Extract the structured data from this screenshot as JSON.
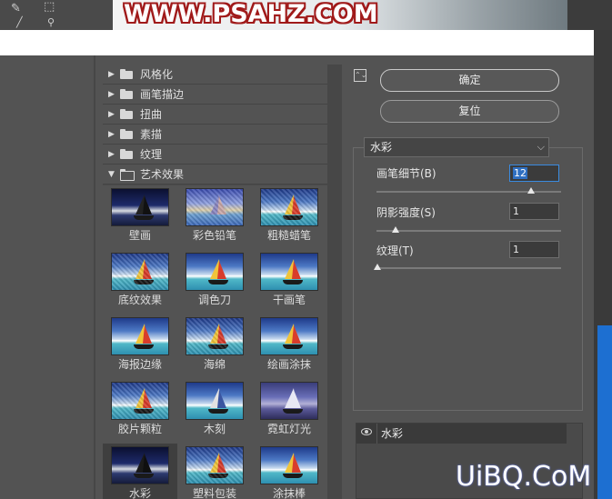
{
  "banner": {
    "text": "WWW.PSAHZ.COM"
  },
  "filter_tree": {
    "categories": [
      {
        "label": "风格化",
        "expanded": false
      },
      {
        "label": "画笔描边",
        "expanded": false
      },
      {
        "label": "扭曲",
        "expanded": false
      },
      {
        "label": "素描",
        "expanded": false
      },
      {
        "label": "纹理",
        "expanded": false
      },
      {
        "label": "艺术效果",
        "expanded": true
      }
    ],
    "thumbnails": [
      {
        "label": "壁画"
      },
      {
        "label": "彩色铅笔"
      },
      {
        "label": "粗糙蜡笔"
      },
      {
        "label": "底纹效果"
      },
      {
        "label": "调色刀"
      },
      {
        "label": "干画笔"
      },
      {
        "label": "海报边缘"
      },
      {
        "label": "海绵"
      },
      {
        "label": "绘画涂抹"
      },
      {
        "label": "胶片颗粒"
      },
      {
        "label": "木刻"
      },
      {
        "label": "霓虹灯光"
      },
      {
        "label": "水彩",
        "selected": true
      },
      {
        "label": "塑料包装"
      },
      {
        "label": "涂抹棒"
      }
    ]
  },
  "buttons": {
    "ok": "确定",
    "reset": "复位"
  },
  "filter_select": {
    "value": "水彩"
  },
  "params": [
    {
      "label": "画笔细节(B)",
      "value": "12",
      "slider_fraction": 0.84
    },
    {
      "label": "阴影强度(S)",
      "value": "1",
      "slider_fraction": 0.1
    },
    {
      "label": "纹理(T)",
      "value": "1",
      "slider_fraction": 0.0
    }
  ],
  "effect_layers": [
    {
      "name": "水彩",
      "visible": true
    }
  ],
  "watermark": {
    "text": "UiBQ.CoM"
  },
  "colors": {
    "panel": "#535353",
    "selected_input_border": "#3a8be0",
    "banner_outline": "#a01a1a"
  }
}
